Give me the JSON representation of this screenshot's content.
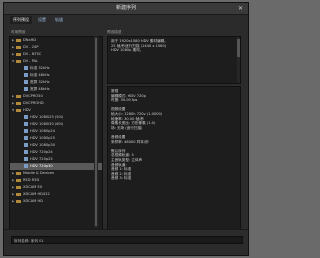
{
  "window": {
    "title": "新建序列",
    "close": "✕"
  },
  "tabs": [
    "序列预设",
    "设置",
    "轨道"
  ],
  "left_panel": {
    "label": "可用预设",
    "items": [
      {
        "kind": "folder",
        "label": "DNxHD",
        "indent": 0,
        "open": false
      },
      {
        "kind": "folder",
        "label": "DV - 24P",
        "indent": 0,
        "open": false
      },
      {
        "kind": "folder",
        "label": "DV - NTSC",
        "indent": 0,
        "open": false
      },
      {
        "kind": "folder",
        "label": "DV - PAL",
        "indent": 0,
        "open": true
      },
      {
        "kind": "doc",
        "label": "标准 32kHz",
        "indent": 1
      },
      {
        "kind": "doc",
        "label": "标准 48kHz",
        "indent": 1
      },
      {
        "kind": "doc",
        "label": "宽屏 32kHz",
        "indent": 1
      },
      {
        "kind": "doc",
        "label": "宽屏 48kHz",
        "indent": 1
      },
      {
        "kind": "folder",
        "label": "DVCPRO50",
        "indent": 0,
        "open": false
      },
      {
        "kind": "folder",
        "label": "DVCPROHD",
        "indent": 0,
        "open": false
      },
      {
        "kind": "folder",
        "label": "HDV",
        "indent": 0,
        "open": true
      },
      {
        "kind": "doc",
        "label": "HDV 1080i25 (50i)",
        "indent": 1
      },
      {
        "kind": "doc",
        "label": "HDV 1080i30 (60i)",
        "indent": 1
      },
      {
        "kind": "doc",
        "label": "HDV 1080p24",
        "indent": 1
      },
      {
        "kind": "doc",
        "label": "HDV 1080p25",
        "indent": 1
      },
      {
        "kind": "doc",
        "label": "HDV 1080p30",
        "indent": 1
      },
      {
        "kind": "doc",
        "label": "HDV 720p24",
        "indent": 1
      },
      {
        "kind": "doc",
        "label": "HDV 720p25",
        "indent": 1
      },
      {
        "kind": "doc",
        "label": "HDV 720p30",
        "indent": 1,
        "selected": true
      },
      {
        "kind": "folder",
        "label": "Mobile & Devices",
        "indent": 0,
        "open": false
      },
      {
        "kind": "folder",
        "label": "RED R3D",
        "indent": 0,
        "open": false
      },
      {
        "kind": "folder",
        "label": "XDCAM EX",
        "indent": 0,
        "open": false
      },
      {
        "kind": "folder",
        "label": "XDCAM HD422",
        "indent": 0,
        "open": false
      },
      {
        "kind": "folder",
        "label": "XDCAM HD",
        "indent": 0,
        "open": false
      }
    ]
  },
  "description": {
    "label": "预设描述",
    "lines": [
      "用于 1920x1080 HDV 素材编辑。",
      "25 帧/秒逐行扫描 (1440 x 1080)",
      "HDV 1080p 素材。"
    ]
  },
  "details": {
    "lines": [
      "常规",
      "编辑模式: HDV 720p",
      "时基: 30.00 fps",
      "",
      "视频设置",
      "帧大小: 1280h 720v (1.0000)",
      "帧速率: 30.00 帧/秒",
      "像素长宽比: 方形像素 (1.0)",
      "场: 无场 (逐行扫描)",
      "",
      "音频设置",
      "采样率: 48000 样本/秒",
      "",
      "默认序列",
      "总视频轨道: 3",
      "主音轨类型: 立体声",
      "音频轨道:",
      "音频 1: 标准",
      "音频 2: 标准",
      "音频 3: 标准"
    ]
  },
  "footer": {
    "label": "序列名称:",
    "value": "序列 01"
  }
}
